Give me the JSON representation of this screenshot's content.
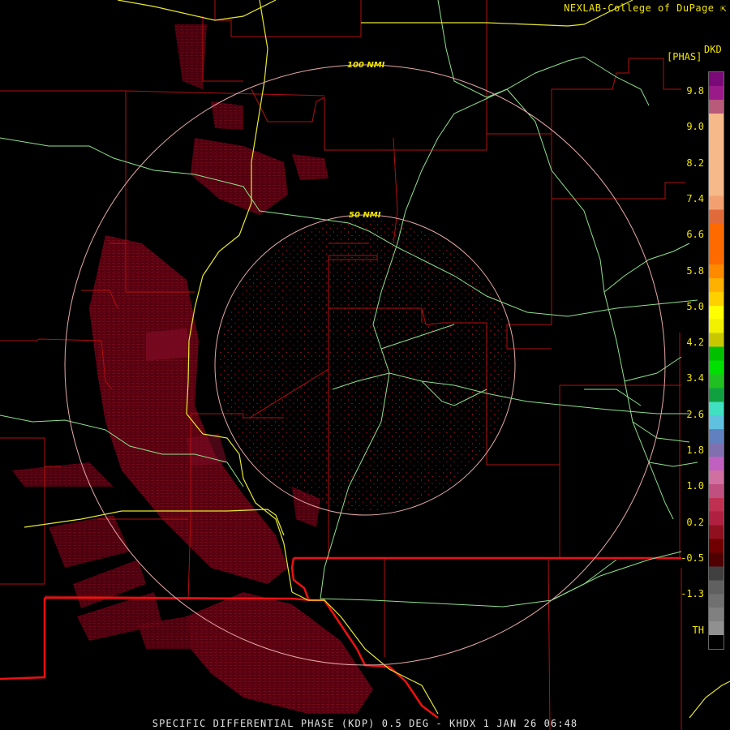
{
  "credit": "NEXLAB-College of DuPage",
  "units": {
    "code": "DKD",
    "label": "[PHAS]"
  },
  "range_rings": [
    {
      "label": "100 NMI"
    },
    {
      "label": "50 NMI"
    }
  ],
  "colorbar": {
    "labels": [
      "9.8",
      "9.0",
      "8.2",
      "7.4",
      "6.6",
      "5.8",
      "5.0",
      "4.2",
      "3.4",
      "2.6",
      "1.8",
      "1.0",
      "0.2",
      "-0.5",
      "-1.3",
      "TH"
    ],
    "colors": [
      "#7a0a78",
      "#9a1a8a",
      "#b85a7a",
      "#f6b98a",
      "#f6b98a",
      "#f6b98a",
      "#f6b98a",
      "#f6b98a",
      "#f6b98a",
      "#f2a070",
      "#e06a3a",
      "#ff6a00",
      "#ff6a00",
      "#ff6a00",
      "#ff8a00",
      "#ffb000",
      "#ffd000",
      "#ffff00",
      "#f0f000",
      "#c8c800",
      "#00c000",
      "#00e000",
      "#20c020",
      "#10a040",
      "#40e0c0",
      "#60c0e0",
      "#6080c0",
      "#8070b0",
      "#c060c0",
      "#d070a0",
      "#c05080",
      "#c03050",
      "#b02040",
      "#901020",
      "#700000",
      "#500000",
      "#404040",
      "#606060",
      "#707070",
      "#808080",
      "#909090",
      "#000000"
    ]
  },
  "footer": "SPECIFIC DIFFERENTIAL PHASE (KDP) 0.5 DEG - KHDX 1 JAN 26 06:48"
}
